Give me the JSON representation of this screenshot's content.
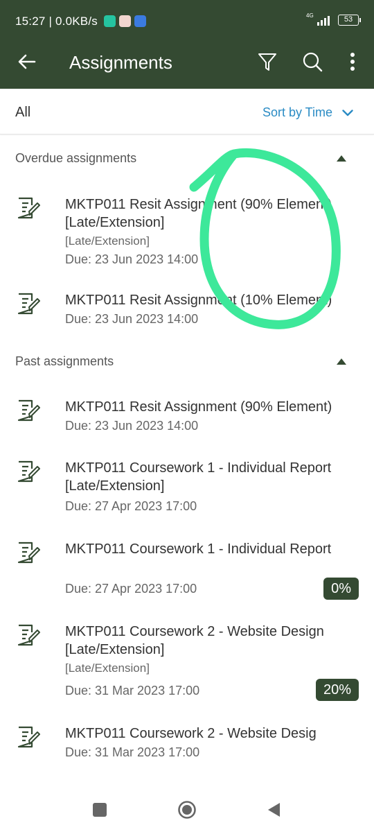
{
  "status_bar": {
    "time": "15:27 | 0.0KB/s",
    "network": "4G",
    "battery": "53"
  },
  "app_bar": {
    "title": "Assignments"
  },
  "filter_bar": {
    "filter_label": "All",
    "sort_label": "Sort by Time"
  },
  "sections": {
    "overdue": {
      "title": "Overdue assignments",
      "items": [
        {
          "title": "MKTP011 Resit Assignment (90% Element) [Late/Extension]",
          "subtitle": "[Late/Extension]",
          "due": "Due: 23 Jun 2023 14:00"
        },
        {
          "title": "MKTP011 Resit Assignment (10% Element)",
          "due": "Due: 23 Jun 2023 14:00"
        }
      ]
    },
    "past": {
      "title": "Past assignments",
      "items": [
        {
          "title": "MKTP011 Resit Assignment (90% Element)",
          "due": "Due: 23 Jun 2023 14:00"
        },
        {
          "title": "MKTP011 Coursework 1 - Individual Report [Late/Extension]",
          "due": "Due: 27 Apr 2023 17:00"
        },
        {
          "title": "MKTP011 Coursework 1 - Individual Report",
          "due": "Due: 27 Apr 2023 17:00",
          "grade": "0%"
        },
        {
          "title": "MKTP011 Coursework 2 - Website Design [Late/Extension]",
          "subtitle": "[Late/Extension]",
          "due": "Due: 31 Mar 2023 17:00",
          "grade": "20%"
        },
        {
          "title": "MKTP011 Coursework 2 - Website Desig",
          "due": "Due: 31 Mar 2023 17:00"
        }
      ]
    }
  },
  "colors": {
    "header": "#344a32",
    "accent": "#2a8bc4",
    "annotation": "#3de89a"
  },
  "icons": {
    "back": "arrow-left",
    "filter": "funnel",
    "search": "magnifier",
    "more": "vertical-dots",
    "assignment": "document-with-pencil",
    "collapse": "triangle-up",
    "sort": "chevron-down"
  }
}
